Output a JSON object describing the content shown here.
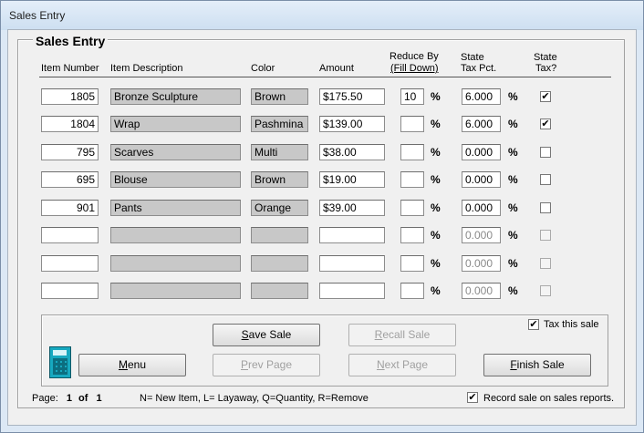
{
  "window": {
    "title": "Sales Entry"
  },
  "group": {
    "legend": "Sales Entry"
  },
  "headers": {
    "item_number": "Item Number",
    "item_description": "Item Description",
    "color": "Color",
    "amount": "Amount",
    "reduce_by": "Reduce By",
    "fill_down": "(Fill Down)",
    "state_tax_pct_1": "State",
    "state_tax_pct_2": "Tax Pct.",
    "state_tax_1": "State",
    "state_tax_2": "Tax?"
  },
  "pct_symbol": "%",
  "rows": [
    {
      "item_number": "1805",
      "description": "Bronze Sculpture",
      "color": "Brown",
      "amount": "$175.50",
      "reduce": "10",
      "tax_pct": "6.000",
      "tax": true,
      "enabled": true
    },
    {
      "item_number": "1804",
      "description": "Wrap",
      "color": "Pashmina",
      "amount": "$139.00",
      "reduce": "",
      "tax_pct": "6.000",
      "tax": true,
      "enabled": true
    },
    {
      "item_number": "795",
      "description": "Scarves",
      "color": "Multi",
      "amount": "$38.00",
      "reduce": "",
      "tax_pct": "0.000",
      "tax": false,
      "enabled": true
    },
    {
      "item_number": "695",
      "description": "Blouse",
      "color": "Brown",
      "amount": "$19.00",
      "reduce": "",
      "tax_pct": "0.000",
      "tax": false,
      "enabled": true
    },
    {
      "item_number": "901",
      "description": "Pants",
      "color": "Orange",
      "amount": "$39.00",
      "reduce": "",
      "tax_pct": "0.000",
      "tax": false,
      "enabled": true
    },
    {
      "item_number": "",
      "description": "",
      "color": "",
      "amount": "",
      "reduce": "",
      "tax_pct": "0.000",
      "tax": false,
      "enabled": false
    },
    {
      "item_number": "",
      "description": "",
      "color": "",
      "amount": "",
      "reduce": "",
      "tax_pct": "0.000",
      "tax": false,
      "enabled": false
    },
    {
      "item_number": "",
      "description": "",
      "color": "",
      "amount": "",
      "reduce": "",
      "tax_pct": "0.000",
      "tax": false,
      "enabled": false
    }
  ],
  "buttons": {
    "save_sale": "Save Sale",
    "recall_sale": "Recall Sale",
    "menu": "Menu",
    "prev_page": "Prev Page",
    "next_page": "Next Page",
    "finish_sale": "Finish Sale"
  },
  "tax_this_sale": {
    "label": "Tax this sale",
    "checked": true
  },
  "record_sale": {
    "label": "Record sale on sales reports.",
    "checked": true
  },
  "footer": {
    "page_label": "Page:",
    "page_current": "1",
    "page_of": "of",
    "page_total": "1",
    "legend_text": "N= New Item,  L= Layaway, Q=Quantity, R=Remove"
  },
  "icons": {
    "calculator": "calculator-icon",
    "check": "check-icon"
  }
}
